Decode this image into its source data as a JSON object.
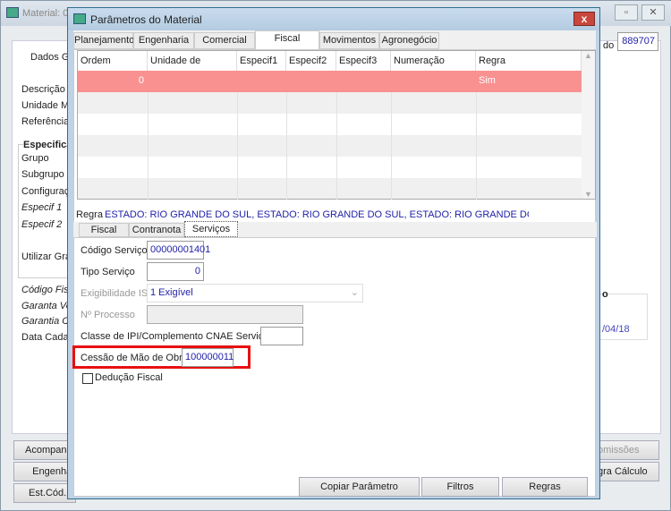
{
  "main_window": {
    "title": "Material: 0",
    "tab": "Dados Ge",
    "code_label": "do",
    "code_value": "889707",
    "labels": [
      "Descrição",
      "Unidade Me",
      "Referência"
    ],
    "group_title": "Especifica",
    "group_labels": [
      "Grupo",
      "Subgrupo",
      "Configuraçã"
    ],
    "italic_labels": [
      "Especif 1",
      "Especif 2"
    ],
    "grade_label": "Utilizar Grad",
    "lower_labels": [
      "Código Fisca",
      "Garanta Ve",
      "Garantia Co"
    ],
    "date_label": "Data Cadast",
    "right_group_title": "o",
    "right_date": "/04/18",
    "buttons_left": [
      "Acompanhar",
      "Engenhar",
      "Est.Cód.Ba"
    ],
    "buttons_right": [
      "omissões",
      "gra Cálculo"
    ]
  },
  "dialog": {
    "title": "Parâmetros do Material",
    "close": "x",
    "tabs": [
      "Planejamento",
      "Engenharia",
      "Comercial",
      "Fiscal",
      "Movimentos",
      "Agronegócio"
    ],
    "grid": {
      "columns": [
        "Ordem",
        "Unidade de Negócio",
        "Especif1",
        "Especif2",
        "Especif3",
        "Numeração",
        "Regra"
      ],
      "rows": [
        {
          "ordem": "0",
          "regra": "Sim"
        }
      ]
    },
    "regra_label": "Regra",
    "regra_value": "ESTADO: RIO GRANDE DO SUL,  ESTADO: RIO GRANDE DO SUL,  ESTADO: RIO GRANDE DO SUL,  ESTADO",
    "subtabs": [
      "Fiscal",
      "Contranota",
      "Serviços"
    ],
    "fields": {
      "codigo_servico": {
        "label": "Código Serviço",
        "value": "00000001401"
      },
      "tipo_servico": {
        "label": "Tipo Serviço",
        "value": "0"
      },
      "exigibilidade": {
        "label": "Exigibilidade ISS",
        "value": "1 Exigível"
      },
      "processo": {
        "label": "Nº Processo",
        "value": ""
      },
      "classe_ipi": {
        "label": "Classe de IPI/Complemento CNAE Serviço",
        "value": ""
      },
      "cessao": {
        "label": "Cessão de Mão de Obra",
        "value": "100000011"
      },
      "deducao": {
        "label": "Dedução Fiscal",
        "checked": false
      }
    },
    "buttons": [
      "Copiar Parâmetro",
      "Filtros",
      "Regras"
    ]
  },
  "colors": {
    "highlight_row": "#f99191",
    "highlight_box": "#e81010",
    "value_text": "#2222aa"
  }
}
